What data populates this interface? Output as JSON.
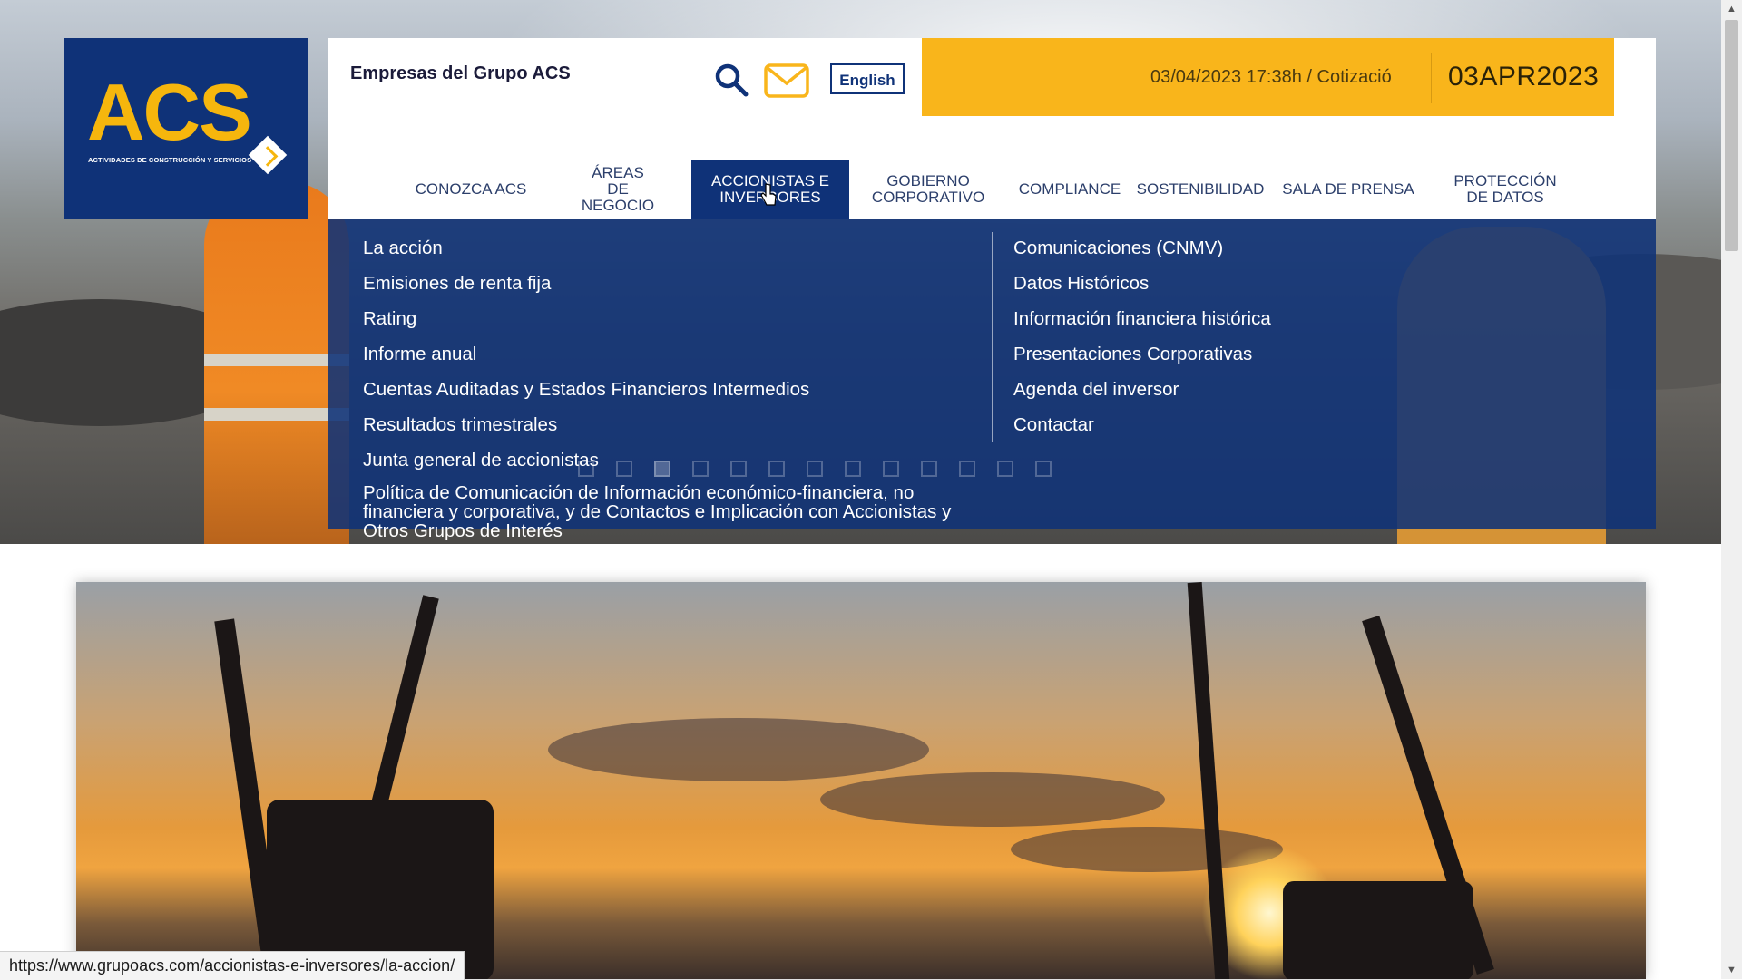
{
  "logo": {
    "mark": "ACS",
    "tagline": "ACTIVIDADES DE CONSTRUCCIÓN Y SERVICIOS"
  },
  "header": {
    "group_link": "Empresas del Grupo ACS",
    "search_icon": "search-icon",
    "mail_icon": "mail-icon",
    "language_button": "English",
    "quote_text": "03/04/2023 17:38h / Cotizació",
    "quote_date": "03APR2023"
  },
  "nav": {
    "items": [
      {
        "label": "CONOZCA ACS"
      },
      {
        "label": "ÁREAS DE NEGOCIO"
      },
      {
        "label": "ACCIONISTAS E INVERSORES",
        "active": true
      },
      {
        "label": "GOBIERNO CORPORATIVO"
      },
      {
        "label": "COMPLIANCE"
      },
      {
        "label": "SOSTENIBILIDAD"
      },
      {
        "label": "SALA DE PRENSA"
      },
      {
        "label": "PROTECCIÓN DE DATOS"
      }
    ]
  },
  "dropdown": {
    "left": [
      "La acción",
      "Emisiones de renta fija",
      "Rating",
      "Informe anual",
      "Cuentas Auditadas y Estados Financieros Intermedios",
      "Resultados trimestrales",
      "Junta general de accionistas",
      "Política de Comunicación de Información económico-financiera, no financiera y corporativa, y de Contactos e Implicación con Accionistas y Otros Grupos de Interés"
    ],
    "right": [
      "Comunicaciones (CNMV)",
      "Datos Históricos",
      "Información financiera histórica",
      "Presentaciones Corporativas",
      "Agenda del inversor",
      "Contactar"
    ]
  },
  "slider": {
    "slide_count": 13,
    "active_index": 3
  },
  "status_bar": {
    "url": "https://www.grupoacs.com/accionistas-e-inversores/la-accion/"
  },
  "colors": {
    "brand_blue": "#0f3278",
    "brand_yellow": "#f9b51b"
  }
}
